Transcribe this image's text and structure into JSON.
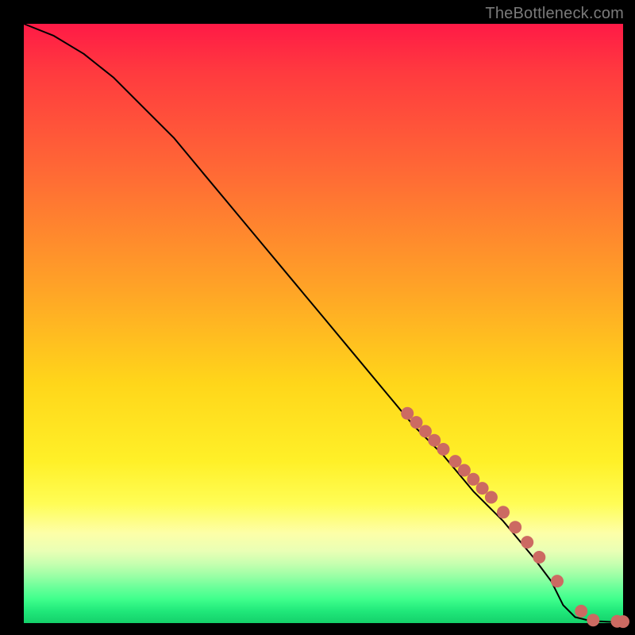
{
  "attribution": "TheBottleneck.com",
  "colors": {
    "dot": "#cc6a62",
    "line": "#000000",
    "gradient_top": "#ff1a46",
    "gradient_bottom": "#14d06a",
    "page_bg": "#000000"
  },
  "chart_data": {
    "type": "line",
    "title": "",
    "xlabel": "",
    "ylabel": "",
    "xlim": [
      0,
      100
    ],
    "ylim": [
      0,
      100
    ],
    "grid": false,
    "legend": false,
    "series": [
      {
        "name": "bottleneck-curve",
        "x": [
          0,
          5,
          10,
          15,
          20,
          25,
          30,
          35,
          40,
          45,
          50,
          55,
          60,
          65,
          70,
          75,
          80,
          85,
          88,
          90,
          92,
          94,
          96,
          98,
          100
        ],
        "y": [
          100,
          98,
          95,
          91,
          86,
          81,
          75,
          69,
          63,
          57,
          51,
          45,
          39,
          33,
          28,
          22,
          17,
          11,
          7,
          3,
          1,
          0.5,
          0.3,
          0.2,
          0.2
        ]
      }
    ],
    "markers": {
      "name": "highlighted-points",
      "x": [
        64,
        65.5,
        67,
        68.5,
        70,
        72,
        73.5,
        75,
        76.5,
        78,
        80,
        82,
        84,
        86,
        89,
        93,
        95,
        99,
        100
      ],
      "y": [
        35,
        33.5,
        32,
        30.5,
        29,
        27,
        25.5,
        24,
        22.5,
        21,
        18.5,
        16,
        13.5,
        11,
        7,
        2,
        0.5,
        0.3,
        0.25
      ]
    }
  }
}
